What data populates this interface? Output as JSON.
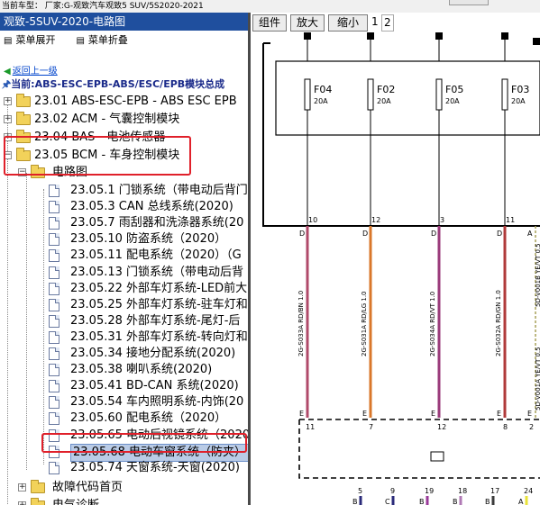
{
  "topbar": {
    "label": "当前车型：  厂家:G-观致汽车观致5 SUV/5S2020-2021"
  },
  "sidebar": {
    "title": "观致-5SUV-2020-电路图",
    "expand_label": "菜单展开",
    "collapse_label": "菜单折叠",
    "back_label": "返回上一级",
    "current_label": "当前:ABS-ESC-EPB-ABS/ESC/EPB模块总成",
    "modules": [
      "23.01 ABS-ESC-EPB - ABS ESC EPB",
      "23.02 ACM - 气囊控制模块",
      "23.04 BAS - 电池传感器",
      "23.05 BCM - 车身控制模块"
    ],
    "folder_label": "电路图",
    "items": [
      "23.05.1 门锁系统（带电动后背门",
      "23.05.3 CAN 总线系统(2020)",
      "23.05.7 雨刮器和洗涤器系统(20",
      "23.05.10 防盗系统（2020）",
      "23.05.11 配电系统（2020）（G",
      "23.05.13 门锁系统（带电动后背",
      "23.05.22 外部车灯系统-LED前大",
      "23.05.25 外部车灯系统-驻车灯和",
      "23.05.28 外部车灯系统-尾灯-后",
      "23.05.31 外部车灯系统-转向灯和",
      "23.05.34 接地分配系统(2020)",
      "23.05.38 喇叭系统(2020)",
      "23.05.41 BD-CAN 系统(2020)",
      "23.05.54 车内照明系统-内饰(20",
      "23.05.60 配电系统（2020）",
      "23.05.65 电动后视镜系统（2020",
      "23.05.68 电动车窗系统（防夹）",
      "23.05.74 天窗系统-天窗(2020)"
    ],
    "extra": [
      "故障代码首页",
      "电气诊断"
    ]
  },
  "toolbar": {
    "components_label": "组件",
    "zoom_in_label": "放大",
    "zoom_out_label": "缩小",
    "pages": [
      "1",
      "2"
    ]
  },
  "diagram": {
    "fuses": [
      {
        "name": "F04",
        "rating": "20A"
      },
      {
        "name": "F02",
        "rating": "20A"
      },
      {
        "name": "F05",
        "rating": "20A"
      },
      {
        "name": "F03",
        "rating": "20A"
      }
    ],
    "top_pins": [
      "10",
      "12",
      "3",
      "11"
    ],
    "wires": [
      {
        "label": "2G-S033A RD/BN 1.0",
        "color": "#b04a6a"
      },
      {
        "label": "2G-S031A RD/LG 1.0",
        "color": "#d9772a"
      },
      {
        "label": "2G-S034A RD/VT 1.0",
        "color": "#9a3a7a"
      },
      {
        "label": "2G-S032A RD/GN 1.0",
        "color": "#b03a3a"
      }
    ],
    "wire_letter_top": "D",
    "wire_letter_bottom": "E",
    "edge_letter_top": "A",
    "edge_letter_bottom": "E",
    "edge_wire_top": "5D-V001B YE/VT 0.5",
    "edge_wire_bottom": "5D-V001A YE/VT 0.5",
    "bottom_pins": [
      "11",
      "7",
      "12",
      "8",
      "2"
    ],
    "lower_pins": [
      "5",
      "9",
      "19",
      "18",
      "17",
      "24"
    ],
    "lower_letters": [
      "B",
      "C",
      "B",
      "B",
      "B",
      "A"
    ]
  }
}
